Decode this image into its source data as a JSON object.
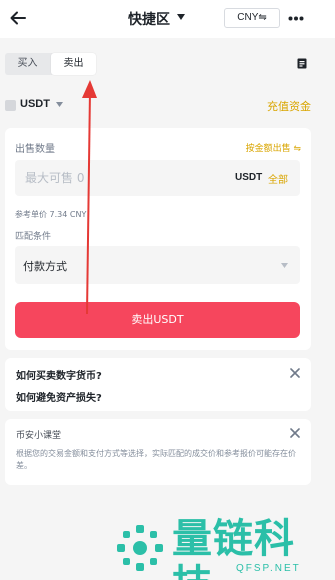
{
  "header": {
    "title": "快捷区",
    "currency_label": "CNY⇋",
    "icons": [
      "back-arrow-icon",
      "chevron-down-icon",
      "more-icon"
    ]
  },
  "trade_tabs": [
    {
      "label": "买入"
    },
    {
      "label": "卖出",
      "selected": true
    }
  ],
  "asset": {
    "label": "USDT",
    "deposit_label": "充值资金"
  },
  "sell_form": {
    "quantity_label": "出售数量",
    "by_amount_label": "按金额出售 ⇋",
    "quantity_placeholder": "最大可售 0",
    "quantity_unit": "USDT",
    "all_label": "全部",
    "reference_price": "参考单价 7.34 CNY",
    "match_label": "匹配条件",
    "payment_method": "付款方式",
    "submit_label": "卖出USDT"
  },
  "faq": {
    "items": [
      "如何买卖数字货币?",
      "如何避免资产损失?"
    ]
  },
  "tips": {
    "title": "币安小课堂",
    "body": "根据您的交易金额和支付方式等选择，实际匹配的成交价和参考报价可能存在价差。"
  },
  "watermark": {
    "name": "量链科技",
    "domain": "QFSP.NET"
  },
  "colors": {
    "accent": "#d9a500",
    "sell": "#f6465d",
    "annotation_arrow": "#e53935",
    "watermark": "#2bbfa8"
  }
}
